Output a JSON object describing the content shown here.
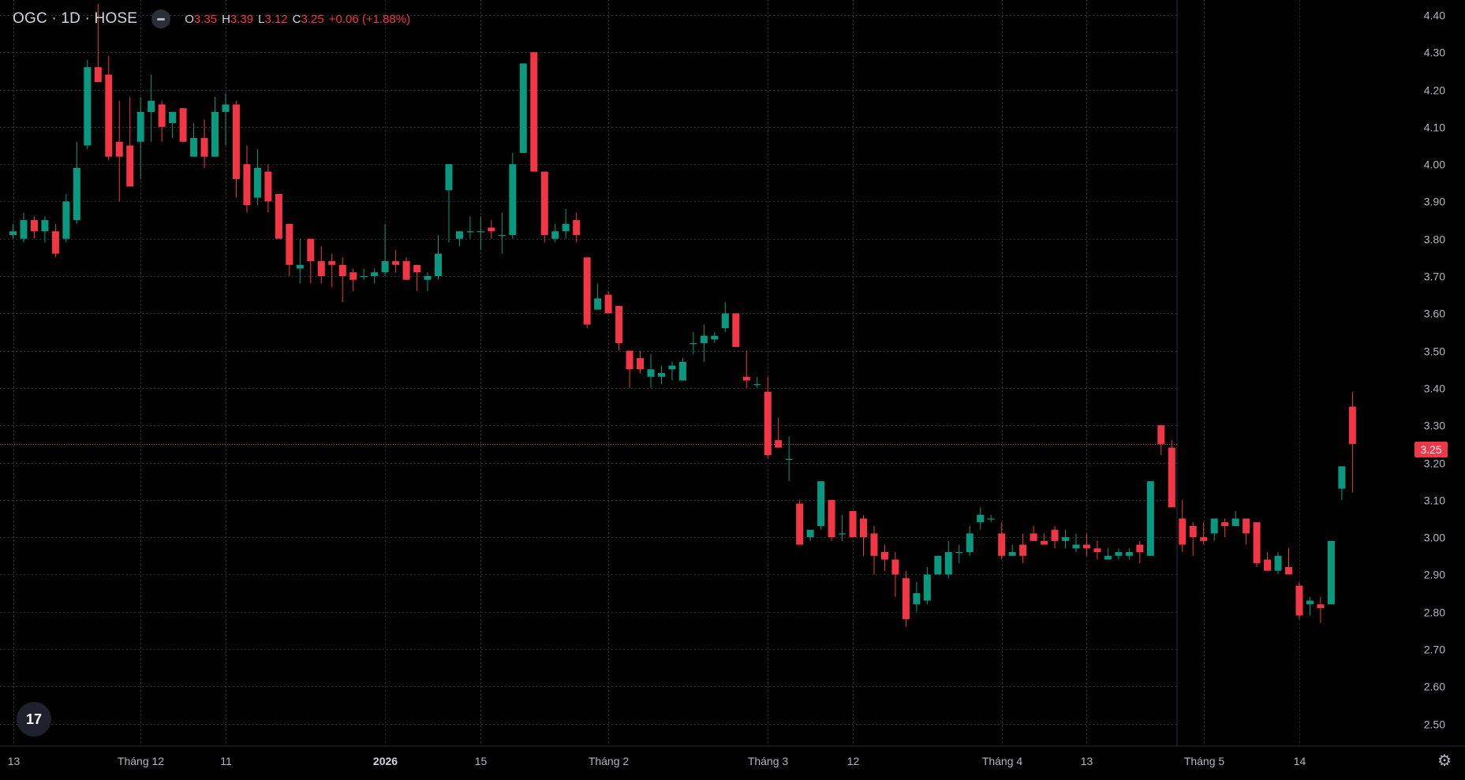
{
  "legend": {
    "symbol": "OGC · 1D · HOSE",
    "o_key": "O",
    "o_val": "3.35",
    "h_key": "H",
    "h_val": "3.39",
    "l_key": "L",
    "l_val": "3.12",
    "c_key": "C",
    "c_val": "3.25",
    "change": "+0.06 (+1.88%)"
  },
  "last_price_label": "3.25",
  "colors": {
    "up": "#089981",
    "down": "#f23645",
    "grid": "#2a2e39",
    "text": "#b2b5be",
    "background": "#000000"
  },
  "icons": {
    "logo": "tradingview-logo-icon",
    "settings": "gear-icon",
    "visibility": "eye-toggle-icon"
  },
  "chart_data": {
    "type": "candlestick",
    "ylim": [
      2.44,
      4.44
    ],
    "y_ticks": [
      "4.40",
      "4.30",
      "4.20",
      "4.10",
      "4.00",
      "3.90",
      "3.80",
      "3.70",
      "3.60",
      "3.50",
      "3.40",
      "3.30",
      "3.20",
      "3.10",
      "3.00",
      "2.90",
      "2.80",
      "2.70",
      "2.60",
      "2.50"
    ],
    "x_ticks": [
      {
        "label": "13",
        "i": 0
      },
      {
        "label": "Tháng 12",
        "i": 12
      },
      {
        "label": "11",
        "i": 20
      },
      {
        "label": "2026",
        "i": 35
      },
      {
        "label": "15",
        "i": 44
      },
      {
        "label": "Tháng 2",
        "i": 56
      },
      {
        "label": "Tháng 3",
        "i": 71
      },
      {
        "label": "12",
        "i": 79
      },
      {
        "label": "Tháng 4",
        "i": 93
      },
      {
        "label": "13",
        "i": 101
      },
      {
        "label": "Tháng 5",
        "i": 112
      },
      {
        "label": "14",
        "i": 121
      }
    ],
    "last_price": 3.25,
    "candles": [
      [
        3.81,
        3.84,
        3.8,
        3.82
      ],
      [
        3.8,
        3.87,
        3.79,
        3.85
      ],
      [
        3.85,
        3.86,
        3.8,
        3.82
      ],
      [
        3.82,
        3.86,
        3.79,
        3.85
      ],
      [
        3.82,
        3.84,
        3.75,
        3.76
      ],
      [
        3.8,
        3.92,
        3.79,
        3.9
      ],
      [
        3.85,
        4.06,
        3.84,
        3.99
      ],
      [
        4.05,
        4.28,
        4.04,
        4.26
      ],
      [
        4.26,
        4.43,
        4.22,
        4.22
      ],
      [
        4.24,
        4.29,
        4.01,
        4.02
      ],
      [
        4.06,
        4.17,
        3.9,
        4.02
      ],
      [
        4.05,
        4.18,
        3.95,
        3.94
      ],
      [
        4.06,
        4.18,
        3.96,
        4.14
      ],
      [
        4.14,
        4.24,
        4.06,
        4.17
      ],
      [
        4.16,
        4.17,
        4.06,
        4.1
      ],
      [
        4.11,
        4.14,
        4.07,
        4.14
      ],
      [
        4.15,
        4.15,
        4.06,
        4.06
      ],
      [
        4.02,
        4.11,
        4.02,
        4.07
      ],
      [
        4.07,
        4.12,
        3.99,
        4.02
      ],
      [
        4.02,
        4.18,
        4.02,
        4.14
      ],
      [
        4.14,
        4.19,
        4.05,
        4.16
      ],
      [
        4.16,
        4.17,
        3.91,
        3.96
      ],
      [
        4.0,
        4.05,
        3.87,
        3.89
      ],
      [
        3.91,
        4.04,
        3.89,
        3.99
      ],
      [
        3.98,
        4.0,
        3.87,
        3.9
      ],
      [
        3.92,
        3.92,
        3.81,
        3.8
      ],
      [
        3.84,
        3.84,
        3.7,
        3.73
      ],
      [
        3.72,
        3.8,
        3.68,
        3.73
      ],
      [
        3.8,
        3.8,
        3.68,
        3.74
      ],
      [
        3.74,
        3.78,
        3.68,
        3.7
      ],
      [
        3.74,
        3.76,
        3.67,
        3.73
      ],
      [
        3.73,
        3.75,
        3.63,
        3.7
      ],
      [
        3.71,
        3.72,
        3.66,
        3.69
      ],
      [
        3.7,
        3.72,
        3.69,
        3.7
      ],
      [
        3.7,
        3.72,
        3.68,
        3.71
      ],
      [
        3.71,
        3.84,
        3.7,
        3.74
      ],
      [
        3.74,
        3.77,
        3.71,
        3.73
      ],
      [
        3.74,
        3.75,
        3.69,
        3.69
      ],
      [
        3.73,
        3.73,
        3.66,
        3.71
      ],
      [
        3.69,
        3.71,
        3.66,
        3.7
      ],
      [
        3.7,
        3.81,
        3.69,
        3.76
      ],
      [
        3.93,
        4.0,
        3.79,
        4.0
      ],
      [
        3.8,
        3.81,
        3.78,
        3.82
      ],
      [
        3.82,
        3.86,
        3.8,
        3.82
      ],
      [
        3.82,
        3.86,
        3.77,
        3.82
      ],
      [
        3.83,
        3.85,
        3.8,
        3.82
      ],
      [
        3.81,
        3.87,
        3.76,
        3.81
      ],
      [
        3.81,
        4.03,
        3.8,
        4.0
      ],
      [
        4.03,
        4.27,
        4.04,
        4.27
      ],
      [
        4.3,
        4.3,
        3.98,
        3.98
      ],
      [
        3.98,
        3.98,
        3.79,
        3.81
      ],
      [
        3.8,
        3.84,
        3.79,
        3.82
      ],
      [
        3.82,
        3.88,
        3.8,
        3.84
      ],
      [
        3.85,
        3.87,
        3.79,
        3.81
      ],
      [
        3.75,
        3.75,
        3.56,
        3.57
      ],
      [
        3.61,
        3.68,
        3.61,
        3.64
      ],
      [
        3.65,
        3.66,
        3.6,
        3.6
      ],
      [
        3.62,
        3.62,
        3.5,
        3.52
      ],
      [
        3.5,
        3.5,
        3.4,
        3.45
      ],
      [
        3.48,
        3.5,
        3.44,
        3.45
      ],
      [
        3.43,
        3.49,
        3.4,
        3.45
      ],
      [
        3.43,
        3.46,
        3.41,
        3.44
      ],
      [
        3.45,
        3.47,
        3.42,
        3.46
      ],
      [
        3.42,
        3.48,
        3.42,
        3.47
      ],
      [
        3.52,
        3.55,
        3.49,
        3.52
      ],
      [
        3.52,
        3.57,
        3.47,
        3.54
      ],
      [
        3.53,
        3.55,
        3.52,
        3.54
      ],
      [
        3.56,
        3.63,
        3.55,
        3.6
      ],
      [
        3.6,
        3.6,
        3.51,
        3.51
      ],
      [
        3.43,
        3.5,
        3.4,
        3.42
      ],
      [
        3.41,
        3.43,
        3.4,
        3.41
      ],
      [
        3.39,
        3.43,
        3.21,
        3.22
      ],
      [
        3.26,
        3.32,
        3.24,
        3.24
      ],
      [
        3.21,
        3.27,
        3.15,
        3.21
      ],
      [
        3.09,
        3.1,
        2.98,
        2.98
      ],
      [
        3.0,
        3.01,
        2.99,
        3.02
      ],
      [
        3.03,
        3.15,
        3.02,
        3.15
      ],
      [
        3.1,
        3.1,
        2.99,
        3.0
      ],
      [
        3.01,
        3.06,
        2.99,
        3.01
      ],
      [
        3.07,
        3.07,
        3.0,
        3.0
      ],
      [
        3.05,
        3.06,
        2.95,
        3.0
      ],
      [
        3.01,
        3.03,
        2.9,
        2.95
      ],
      [
        2.96,
        2.98,
        2.91,
        2.94
      ],
      [
        2.94,
        2.96,
        2.84,
        2.9
      ],
      [
        2.89,
        2.91,
        2.76,
        2.78
      ],
      [
        2.82,
        2.88,
        2.8,
        2.85
      ],
      [
        2.83,
        2.92,
        2.82,
        2.9
      ],
      [
        2.9,
        2.95,
        2.9,
        2.95
      ],
      [
        2.9,
        2.99,
        2.89,
        2.96
      ],
      [
        2.96,
        2.98,
        2.93,
        2.96
      ],
      [
        2.96,
        3.03,
        2.95,
        3.01
      ],
      [
        3.04,
        3.08,
        3.02,
        3.06
      ],
      [
        3.05,
        3.06,
        3.04,
        3.05
      ],
      [
        3.01,
        3.04,
        2.94,
        2.95
      ],
      [
        2.95,
        2.98,
        2.95,
        2.96
      ],
      [
        2.98,
        3.01,
        2.93,
        2.95
      ],
      [
        3.01,
        3.03,
        2.99,
        2.99
      ],
      [
        2.99,
        3.01,
        2.98,
        2.98
      ],
      [
        3.02,
        3.03,
        2.97,
        2.99
      ],
      [
        2.99,
        3.02,
        2.97,
        3.0
      ],
      [
        2.97,
        3.01,
        2.96,
        2.98
      ],
      [
        2.98,
        3.01,
        2.95,
        2.97
      ],
      [
        2.97,
        2.99,
        2.94,
        2.96
      ],
      [
        2.94,
        2.97,
        2.94,
        2.95
      ],
      [
        2.95,
        2.97,
        2.94,
        2.96
      ],
      [
        2.95,
        2.97,
        2.94,
        2.96
      ],
      [
        2.98,
        2.99,
        2.93,
        2.96
      ],
      [
        2.95,
        3.15,
        2.95,
        3.15
      ],
      [
        3.3,
        3.3,
        3.22,
        3.25
      ],
      [
        3.24,
        3.26,
        3.08,
        3.08
      ],
      [
        3.05,
        3.1,
        2.96,
        2.98
      ],
      [
        3.03,
        3.04,
        2.95,
        3.0
      ],
      [
        3.0,
        3.04,
        2.98,
        2.99
      ],
      [
        3.01,
        3.05,
        2.99,
        3.05
      ],
      [
        3.04,
        3.05,
        3.0,
        3.03
      ],
      [
        3.03,
        3.07,
        3.03,
        3.05
      ],
      [
        3.05,
        3.05,
        2.98,
        3.01
      ],
      [
        3.04,
        3.04,
        2.92,
        2.93
      ],
      [
        2.94,
        2.96,
        2.91,
        2.91
      ],
      [
        2.91,
        2.96,
        2.9,
        2.95
      ],
      [
        2.92,
        2.97,
        2.9,
        2.9
      ],
      [
        2.87,
        2.88,
        2.78,
        2.79
      ],
      [
        2.82,
        2.84,
        2.79,
        2.83
      ],
      [
        2.82,
        2.84,
        2.77,
        2.81
      ],
      [
        2.82,
        2.99,
        2.82,
        2.99
      ],
      [
        3.13,
        3.19,
        3.1,
        3.19
      ],
      [
        3.35,
        3.39,
        3.12,
        3.25
      ]
    ]
  }
}
